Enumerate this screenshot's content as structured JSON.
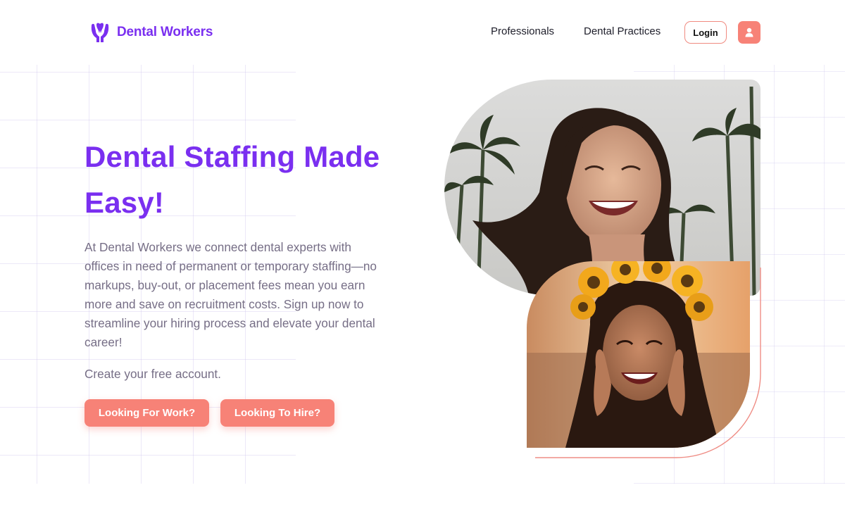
{
  "header": {
    "brand": "Dental Workers",
    "nav": [
      {
        "label": "Professionals"
      },
      {
        "label": "Dental Practices"
      }
    ],
    "login_label": "Login",
    "user_icon": "user-icon"
  },
  "hero": {
    "title": "Dental Staffing Made Easy!",
    "description": "At Dental Workers we connect dental experts with offices in need of permanent or temporary staffing—no markups, buy-out, or placement fees mean you earn more and save on recruitment costs. Sign up now to streamline your hiring process and elevate your dental career!",
    "cta_text": "Create your free account.",
    "buttons": {
      "work": "Looking For Work?",
      "hire": "Looking To Hire?"
    }
  },
  "images": {
    "photo_1": "smiling woman with palm trees",
    "photo_2": "smiling woman with sunflower crown"
  },
  "colors": {
    "brand": "#7a2ff0",
    "accent": "#f78277",
    "body_text": "#766e86"
  }
}
